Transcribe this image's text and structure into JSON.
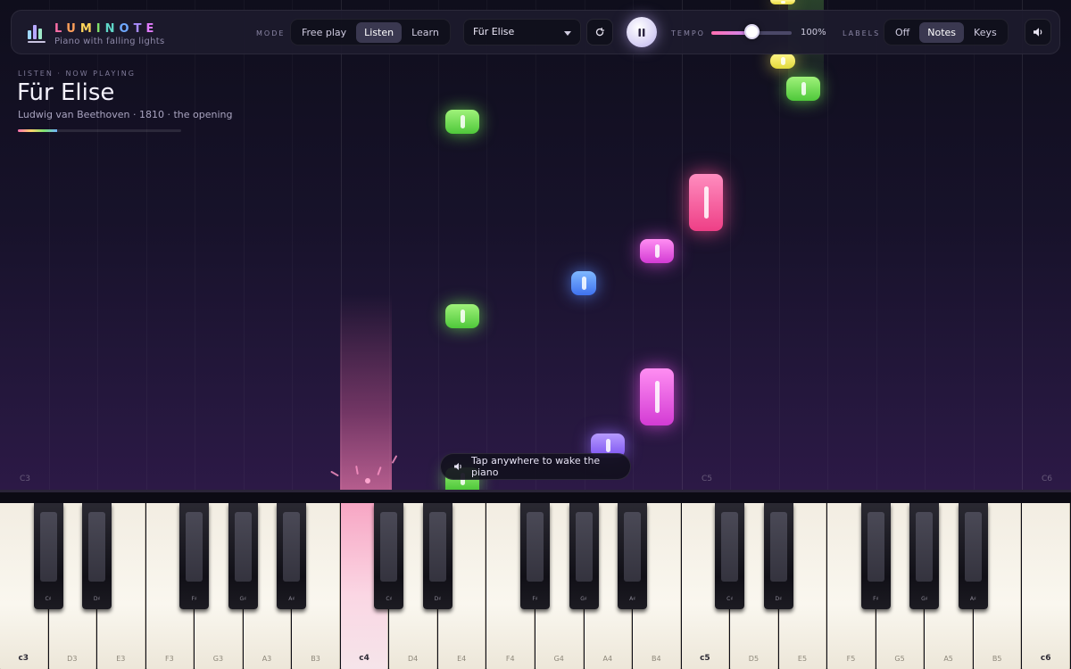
{
  "app": {
    "brand_letters": [
      "L",
      "U",
      "M",
      "I",
      "N",
      "O",
      "T",
      "E"
    ],
    "brand_colors": [
      "#ff6fa8",
      "#ff9f5a",
      "#ffd45a",
      "#7fe06a",
      "#5fd6c8",
      "#6fa8ff",
      "#a88bff",
      "#e07bff"
    ],
    "tagline": "Piano with falling lights"
  },
  "header": {
    "mode_label": "MODE",
    "modes": [
      "Free play",
      "Listen",
      "Learn"
    ],
    "active_mode": "Listen",
    "song_select": {
      "value": "Für Elise"
    },
    "restart_icon": "restart-icon",
    "play_state_icon": "pause-icon",
    "tempo_label": "TEMPO",
    "tempo_value": "100%",
    "tempo_fraction": 0.5,
    "labels_label": "LABELS",
    "labels": [
      "Off",
      "Notes",
      "Keys"
    ],
    "active_label": "Notes",
    "sound_icon": "speaker-icon"
  },
  "song": {
    "eyebrow": "LISTEN · NOW PLAYING",
    "title": "Für Elise",
    "subtitle": "Ludwig van Beethoven · 1810 · the opening",
    "progress": 0.24
  },
  "toast": {
    "icon": "speaker-icon",
    "text": "Tap anywhere to wake the piano"
  },
  "lane_labels": [
    "C3",
    "C5",
    "C6"
  ],
  "keyboard": {
    "white_keys": [
      "C3",
      "D3",
      "E3",
      "F3",
      "G3",
      "A3",
      "B3",
      "C4",
      "D4",
      "E4",
      "F4",
      "G4",
      "A4",
      "B4",
      "C5",
      "D5",
      "E5",
      "F5",
      "G5",
      "A5",
      "B5",
      "C6"
    ],
    "black_keys": [
      "C♯",
      "D♯",
      "F♯",
      "G♯",
      "A♯",
      "C♯",
      "D♯",
      "F♯",
      "G♯",
      "A♯",
      "C♯",
      "D♯",
      "F♯",
      "G♯",
      "A♯"
    ],
    "pressed": [
      "C4"
    ]
  }
}
